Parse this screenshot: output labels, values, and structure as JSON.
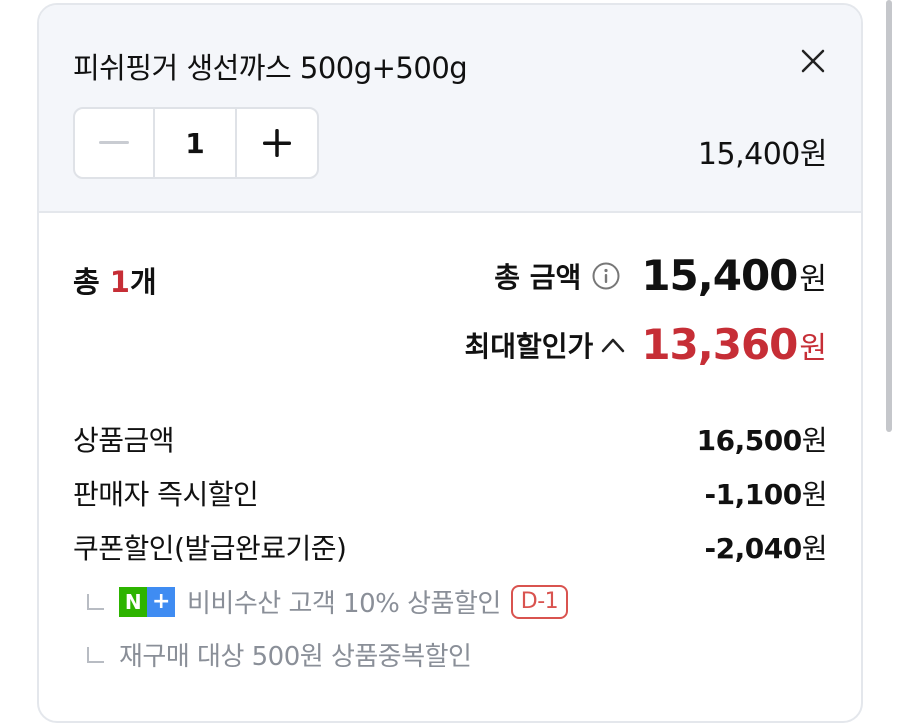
{
  "option": {
    "product_name": "피쉬핑거 생선까스 500g+500g",
    "quantity": "1",
    "price": "15,400원"
  },
  "summary": {
    "count_prefix": "총 ",
    "count_value": "1",
    "count_suffix": "개",
    "total_label": "총 금액",
    "total_amount": "15,400",
    "total_unit": "원",
    "max_discount_label": "최대할인가",
    "max_discount_amount": "13,360",
    "max_discount_unit": "원"
  },
  "breakdown": [
    {
      "label": "상품금액",
      "value": "16,500",
      "unit": "원"
    },
    {
      "label": "판매자 즉시할인",
      "value": "-1,100",
      "unit": "원"
    },
    {
      "label": "쿠폰할인(발급완료기준)",
      "value": "-2,040",
      "unit": "원"
    }
  ],
  "coupon_details": [
    {
      "badge_n": "N",
      "badge_plus": "+",
      "text": "비비수산 고객 10% 상품할인",
      "dday": "D-1"
    },
    {
      "text": "재구매 대상 500원 상품중복할인"
    }
  ],
  "colors": {
    "accent_red": "#c62e36",
    "panel_bg": "#f4f6fa",
    "naver_green": "#2db400",
    "plus_blue": "#3f8cf2"
  },
  "icons": [
    "close-icon",
    "minus-icon",
    "plus-icon",
    "info-icon",
    "chevron-up-icon",
    "corner-bracket-icon"
  ]
}
